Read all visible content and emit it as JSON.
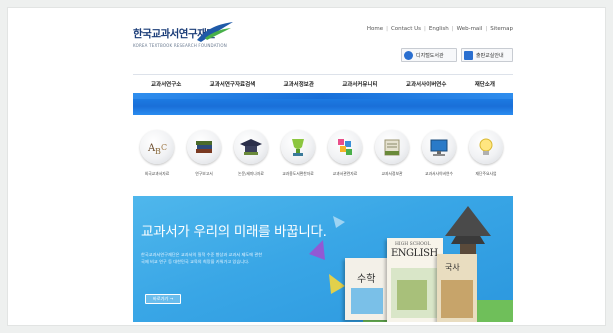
{
  "colors": {
    "brand_blue": "#1a6fd8",
    "hero_blue": "#39a6e6",
    "text_dark": "#222222"
  },
  "header": {
    "logo_title": "한국교과서연구재단",
    "logo_subtitle": "KOREA TEXTBOOK RESEARCH FOUNDATION",
    "util_links": [
      "Home",
      "Contact Us",
      "English",
      "Web-mail",
      "Sitemap"
    ],
    "quick_buttons": [
      {
        "label": "디지털도서관",
        "icon": "search-icon"
      },
      {
        "label": "출판교실안내",
        "icon": "book-icon"
      }
    ]
  },
  "nav": {
    "items": [
      "교과서연구소",
      "교과서연구자료검색",
      "교과서정보관",
      "교과서커뮤니티",
      "교과서사이버연수",
      "재단소개"
    ]
  },
  "icons": [
    {
      "icon": "abc-blocks-icon",
      "label": "외국교과서자료"
    },
    {
      "icon": "book-stack-icon",
      "label": "연구보고서"
    },
    {
      "icon": "graduation-cap-icon",
      "label": "논문/세미나자료"
    },
    {
      "icon": "trophy-icon",
      "label": "교과용도서편찬자료"
    },
    {
      "icon": "blocks-icon",
      "label": "교과서관련자료"
    },
    {
      "icon": "books-icon",
      "label": "교과서정보관"
    },
    {
      "icon": "computer-icon",
      "label": "교과서사이버연수"
    },
    {
      "icon": "lightbulb-icon",
      "label": "재단주요사업"
    }
  ],
  "hero": {
    "title": "교과서가 우리의 미래를 바꿉니다.",
    "desc_line1": "한국교과서연구재단은 교과서의 질적 수준 향상과 교과서 제도에 관한",
    "desc_line2": "국제 비교 연구 등 대한민국 교육의 희망을 키워가고 있습니다.",
    "button_label": "바로가기 →",
    "book_titles": [
      "수학",
      "ENGLISH",
      "국사"
    ],
    "book_subtitle": "HIGH SCHOOL"
  }
}
